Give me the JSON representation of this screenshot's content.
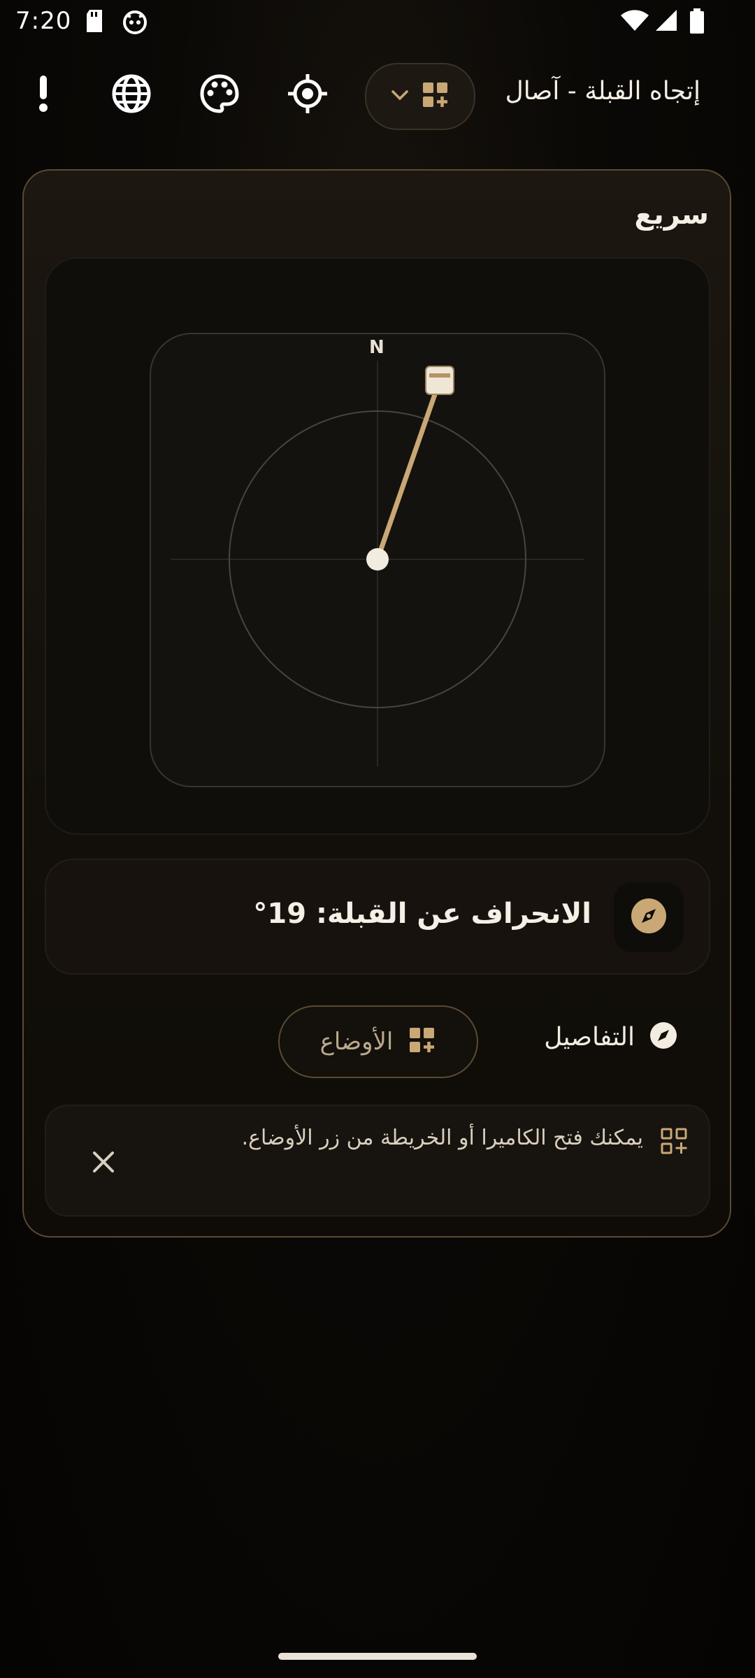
{
  "status_bar": {
    "time": "7:20"
  },
  "app_bar": {
    "title": "إتجاه القبلة - آصال"
  },
  "card": {
    "title": "سريع",
    "compass": {
      "north_label": "N"
    },
    "deviation_text": "الانحراف عن القبلة: 19°",
    "details_label": "التفاصيل",
    "modes_label": "الأوضاع",
    "hint_text": "يمكنك فتح الكاميرا أو الخريطة من زر الأوضاع."
  },
  "colors": {
    "accent": "#c9a875",
    "card_border": "#5a4a33"
  }
}
